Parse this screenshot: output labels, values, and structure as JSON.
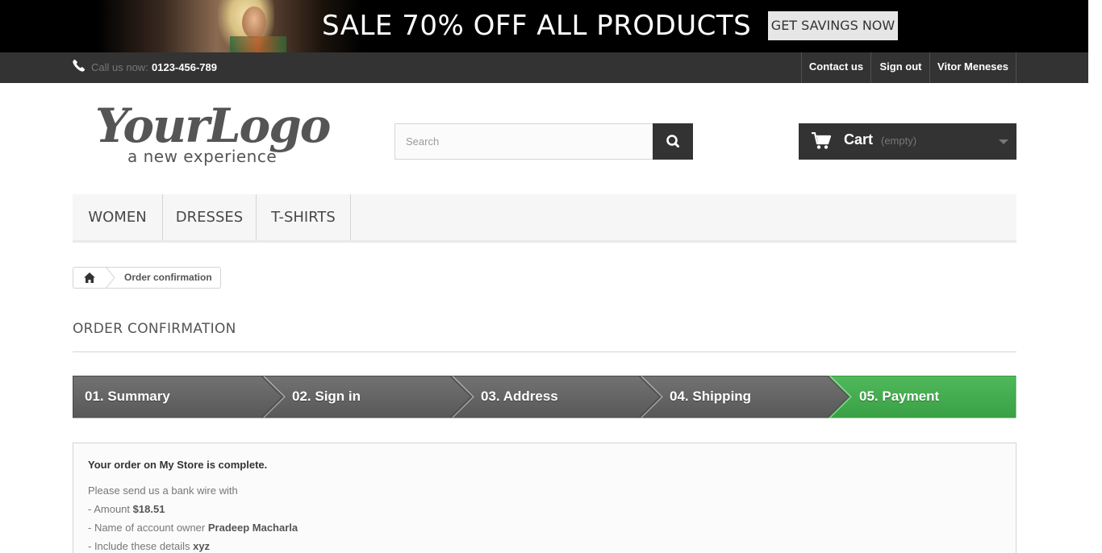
{
  "banner": {
    "headline": "SALE 70% OFF ALL PRODUCTS",
    "cta_label": "GET SAVINGS NOW"
  },
  "topbar": {
    "call_label": "Call us now:",
    "phone_number": "0123-456-789",
    "links": [
      "Contact us",
      "Sign out",
      "Vitor Meneses"
    ]
  },
  "header": {
    "logo_text": "YourLogo",
    "logo_tagline": "a new experience",
    "search_placeholder": "Search",
    "cart_label": "Cart",
    "cart_status": "(empty)"
  },
  "menu": {
    "items": [
      "WOMEN",
      "DRESSES",
      "T-SHIRTS"
    ]
  },
  "breadcrumb": {
    "current": "Order confirmation"
  },
  "page": {
    "title": "ORDER CONFIRMATION"
  },
  "steps": {
    "items": [
      "01. Summary",
      "02. Sign in",
      "03. Address",
      "04. Shipping",
      "05. Payment"
    ],
    "active_index": 4,
    "active_color": "#46a74e",
    "inactive_color": "#616161"
  },
  "confirmation": {
    "heading": "Your order on My Store is complete.",
    "intro": "Please send us a bank wire with",
    "amount_label": "- Amount",
    "amount_value": "$18.51",
    "owner_label": "- Name of account owner",
    "owner_value": "Pradeep Macharla",
    "details_label": "- Include these details",
    "details_value": "xyz"
  },
  "icons": {
    "phone": "phone-icon",
    "search": "search-icon",
    "cart": "cart-icon",
    "home": "home-icon"
  }
}
